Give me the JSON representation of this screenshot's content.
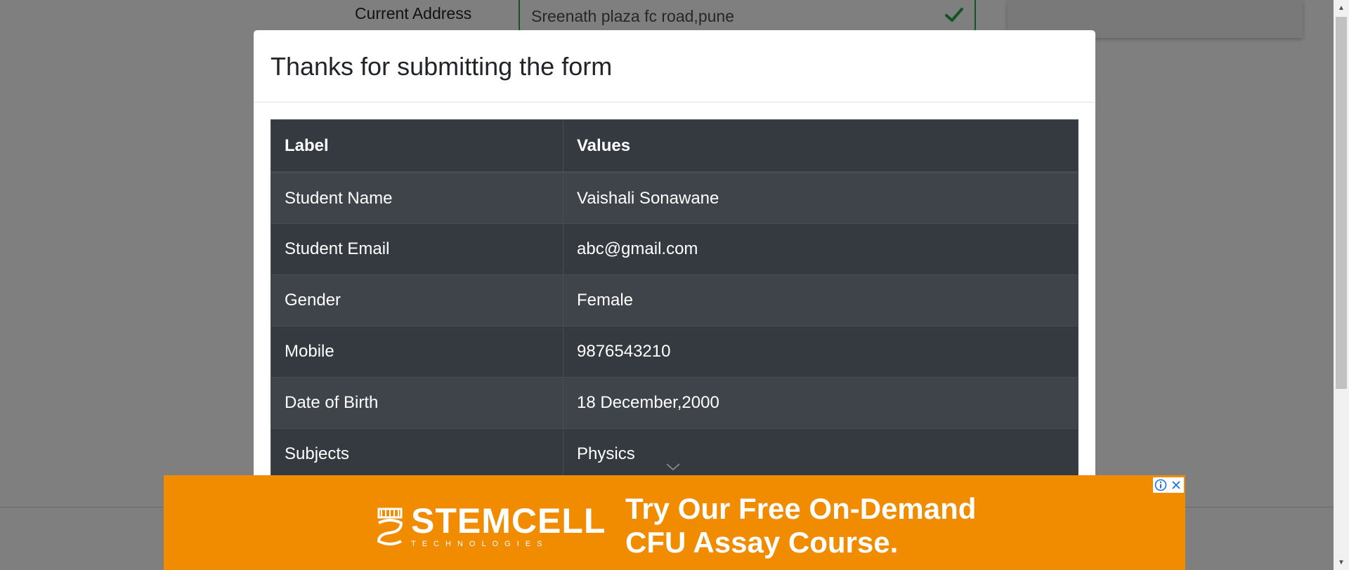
{
  "background_form": {
    "current_address_label": "Current Address",
    "current_address_value": "Sreenath plaza fc road,pune"
  },
  "modal": {
    "title": "Thanks for submitting the form",
    "table": {
      "headers": [
        "Label",
        "Values"
      ],
      "rows": [
        {
          "label": "Student Name",
          "value": "Vaishali Sonawane"
        },
        {
          "label": "Student Email",
          "value": "abc@gmail.com"
        },
        {
          "label": "Gender",
          "value": "Female"
        },
        {
          "label": "Mobile",
          "value": "9876543210"
        },
        {
          "label": "Date of Birth",
          "value": "18 December,2000"
        },
        {
          "label": "Subjects",
          "value": "Physics"
        }
      ]
    }
  },
  "ad": {
    "brand": "STEMCELL",
    "brand_sub": "TECHNOLOGIES",
    "headline_line1": "Try Our Free On-Demand",
    "headline_line2": "CFU Assay Course.",
    "info_icon": "info-icon",
    "close_icon": "close-icon"
  },
  "colors": {
    "ad_background": "#f18b00",
    "table_dark": "#343a40",
    "valid_green": "#28a745"
  }
}
